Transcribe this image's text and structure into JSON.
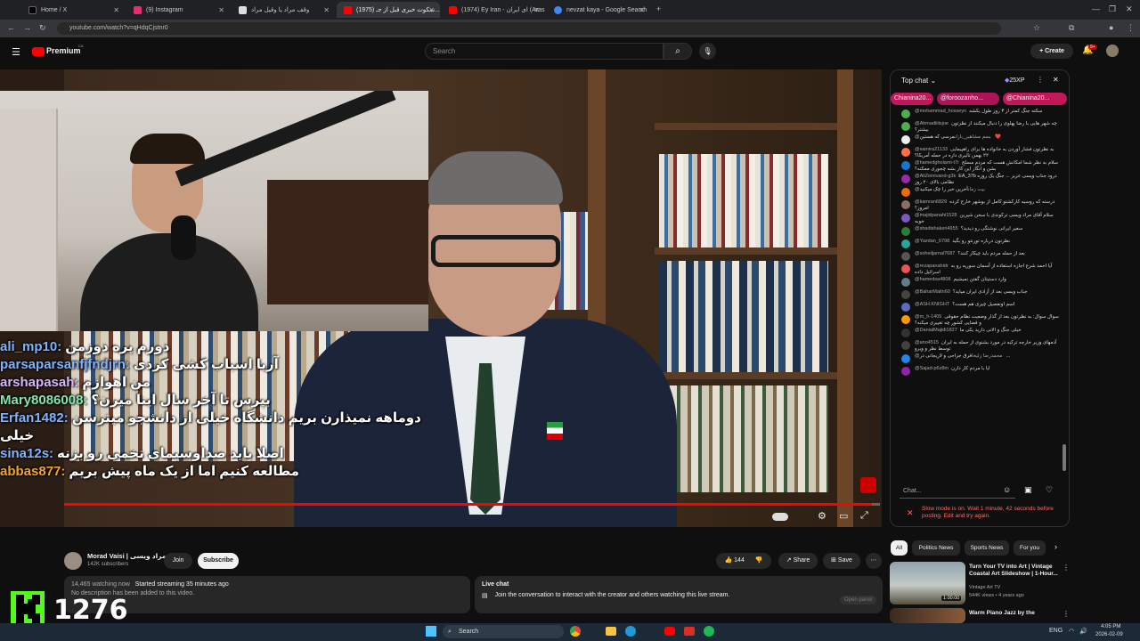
{
  "browser": {
    "tabs": [
      {
        "label": "Home / X",
        "color": "#ffffff"
      },
      {
        "label": "(9) Instagram",
        "color": "#e1306c"
      },
      {
        "label": "وقف مراد یا وقیل مراد",
        "color": "#dddddd"
      },
      {
        "label": "(1975) سکوت خبری قبل از جـ...",
        "color": "#ff0000"
      },
      {
        "label": "(1974) Ey Iran - ای ایران (Arash...",
        "color": "#ff0000"
      },
      {
        "label": "nevzat kaya - Google Search",
        "color": "#4285f4"
      }
    ],
    "url": "youtube.com/watch?v=qHdqCjstnr0"
  },
  "youtube": {
    "logo_text": "Premium",
    "logo_sup": "CA",
    "search_placeholder": "Search",
    "create_label": "Create",
    "notif_count": "9+"
  },
  "video": {
    "overlay_chat": [
      {
        "user": "ali_mp10:",
        "msg": "دورم پره دوزمن",
        "color": "#7fb3ff"
      },
      {
        "user": "parsaparsanfjfndjrn:",
        "msg": "آریا اسباب کشی کردی",
        "color": "#7fb3ff"
      },
      {
        "user": "arshapasah:",
        "msg": "من اهوازم",
        "color": "#d7b7ff"
      },
      {
        "user": "Mary8086008:",
        "msg": "بپرس تا آخر سال اینا میرن؟",
        "color": "#7fe8b0"
      },
      {
        "user": "Erfan1482:",
        "msg": "دوماهه نمیذارن بریم دانشگاه خیلی از دانشجو میترسن خیلی",
        "color": "#7fb3ff"
      },
      {
        "user": "sina12s:",
        "msg": "اصلا باید صداوسیمای تخمی رو بزنه",
        "color": "#7fb3ff"
      },
      {
        "user": "abbas877:",
        "msg": "مطالعه کنیم اما از یک ماه پیش بریم",
        "color": "#f5a623"
      }
    ],
    "progress_fraction": 0.99
  },
  "channel": {
    "name": "Morad Vaisi | مراد ویسی",
    "subscribers": "142K subscribers",
    "join_label": "Join",
    "subscribe_label": "Subscribe",
    "like_count": "144",
    "share_label": "Share",
    "save_label": "Save"
  },
  "description": {
    "watching": "14,465 watching now",
    "started": "Started streaming 35 minutes ago",
    "text": "No description has been added to this video."
  },
  "livechat_box": {
    "title": "Live chat",
    "text": "Join the conversation to interact with the creator and others watching this live stream.",
    "button": "Open panel"
  },
  "chat": {
    "header": "Top chat",
    "xp": "25XP",
    "ticker": [
      "Chianina20...",
      "@foroozanho...",
      "@Chianina20..."
    ],
    "messages": [
      {
        "user": "@mohammad_hosseyn",
        "text": "سکته جنگ کمتر از ۳ روز طول بکشه",
        "color": "#4caf50"
      },
      {
        "user": "@Ahmadiiiisjoe",
        "text": "چه شهر هایی با رضا پهلوی را دنبال میکنند از نظرتون بیشتر؟",
        "color": "#4caf50"
      },
      {
        "user": "@بسم مشاهیر_بازان",
        "text": "مرسی که هستین ❤️",
        "color": "#eeeeee"
      },
      {
        "user": "@samira21133",
        "text": "به نظرتون فشار آوردن به خانواده ها برای راهپیمایی ۲۲ بهمن تاثیری داره در حمله آمریکا؟",
        "color": "#ff7043"
      },
      {
        "user": "@hamedgholami-t7r",
        "text": "سلام به نظر شما امکانش هست که مردم مسلح بشن و انگار این کار بشه چجوری ممکنه؟",
        "color": "#1976d2"
      },
      {
        "user": "@AliZeinivand-g3k",
        "text": "EA_37b درود جناب ویسی عزیز ... جنگ یک روزه نظامی بالای ۲۰ روز",
        "color": "#9c27b0"
      },
      {
        "user": "@بیت زمان",
        "text": "آخرین خبر را چک میکنید",
        "color": "#ef6c00"
      },
      {
        "user": "@kamran6829",
        "text": "درسته که روسیه کارکشتو کامل از بوشهر خارج کرده امروز؟",
        "color": "#8d6e63"
      },
      {
        "user": "@majidpanahi1528",
        "text": "سلام آقای مراد ویسی ترکوندی با سخن شیرین خوبه",
        "color": "#7e57c2"
      },
      {
        "user": "@shadishakeri4955",
        "text": "سفیر ایرانی نوشتگی رو دیدید؟",
        "color": "#2e7d32"
      },
      {
        "user": "@Yazdan_6798",
        "text": "نظرتون درباره تورنتو رو بگید",
        "color": "#26a69a"
      },
      {
        "user": "@soheiljamal7687",
        "text": "بعد از حمله مردم باید چیکار کنند؟",
        "color": "#555555"
      },
      {
        "user": "@rezapanahidr",
        "text": "آیا احمد شرع اجازه استفاده از آسمان سوریه رو به اسرائیل داده",
        "color": "#ef5350"
      },
      {
        "user": "@hamedsa4808",
        "text": "وارد دستیتان گفتن نمیشیم",
        "color": "#607d8b"
      },
      {
        "user": "@BaharMatin60",
        "text": "جناب ویسی بعد از آزادی ایران میاید؟",
        "color": "#444444"
      },
      {
        "user": "@ASH.KNIGHT",
        "text": "اسم اونفصیل چیزی هم هست؟",
        "color": "#5c6bc0"
      },
      {
        "user": "@m_h-1405",
        "text": "سوال سوال: به نظرتون بعد از گذار وضعیت نظام حقوقی و قضایی کشور چه تغییری میکنه؟",
        "color": "#ff9800"
      },
      {
        "user": "@DanialMajidi1827",
        "text": "خیلی جنگ و الانی دارید یکی ما",
        "color": "#333333"
      },
      {
        "user": "@ano4515",
        "text": "آدمهای وزیر خارجه ترکیه در مورد بشنوی از حمله به ایران توسط نظر و ویرو",
        "color": "#424242"
      },
      {
        "user": "@محمدرضا زلیخا",
        "text": "فرق جراحی و لاریجانی در ...",
        "color": "#1e88e5"
      },
      {
        "user": "@Sajad-p6z8m",
        "text": "ایا با مردم کار دارن",
        "color": "#8e24aa"
      }
    ],
    "input_placeholder": "Chat...",
    "slow_mode": "Slow mode is on. Wait 1 minute, 42 seconds before posting. Edit and try again."
  },
  "filters": [
    "All",
    "Politics News",
    "Sports News",
    "For you"
  ],
  "recommendations": [
    {
      "title": "Turn Your TV into Art | Vintage Coastal Art Slideshow | 1-Hour...",
      "channel": "Vintage Art TV",
      "meta": "544K views • 4 years ago",
      "duration": "1:00:00"
    },
    {
      "title": "Warm Piano Jazz by the",
      "channel": "",
      "meta": "",
      "duration": ""
    }
  ],
  "overlay": {
    "viewers": "1276"
  },
  "taskbar": {
    "search_label": "Search",
    "time": "4:05 PM",
    "date": "2026-02-09",
    "lang": "ENG"
  }
}
